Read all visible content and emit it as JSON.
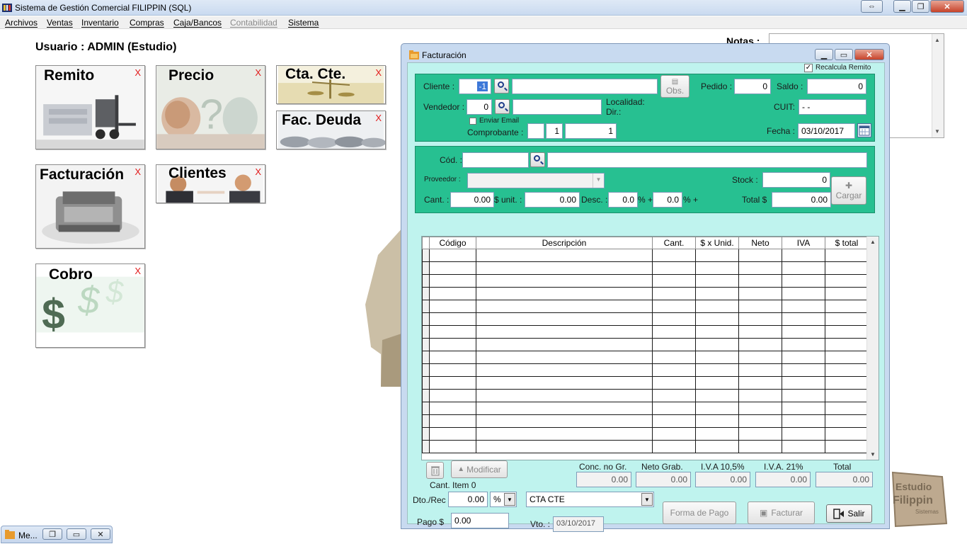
{
  "window": {
    "title": "Sistema de Gestión Comercial FILIPPIN (SQL)"
  },
  "menu": [
    "Archivos",
    "Ventas",
    "Inventario",
    "Compras",
    "Caja/Bancos",
    "Contabilidad",
    "Sistema"
  ],
  "user_label": "Usuario : ADMIN  (Estudio)",
  "tiles": {
    "remito": "Remito",
    "precio": "Precio",
    "ctacte": "Cta. Cte.",
    "facdeuda": "Fac. Deuda",
    "facturacion": "Facturación",
    "clientes": "Clientes",
    "cobro": "Cobro",
    "close_x": "X"
  },
  "notes_label": "Notas :",
  "fac": {
    "title": "Facturación",
    "recalcula": "Recalcula Remito",
    "cliente_label": "Cliente :",
    "cliente_value": "-1",
    "obs": "Obs.",
    "pedido_label": "Pedido :",
    "pedido_value": "0",
    "saldo_label": "Saldo :",
    "saldo_value": "0",
    "vendedor_label": "Vendedor :",
    "vendedor_value": "0",
    "localidad_label": "Localidad:",
    "dir_label": "Dir.:",
    "cuit_label": "CUIT:",
    "cuit_value": "-      -",
    "enviar_email": "Enviar Email",
    "comprobante_label": "Comprobante :",
    "comp_value1": "1",
    "comp_value2": "1",
    "fecha_label": "Fecha :",
    "fecha_value": "03/10/2017",
    "cod_label": "Cód. :",
    "proveedor_label": "Proveedor :",
    "stock_label": "Stock :",
    "stock_value": "0",
    "cargar": "Cargar",
    "cant_label": "Cant. :",
    "cant_value": "0.00",
    "unit_label": "$ unit. :",
    "unit_value": "0.00",
    "desc_label": "Desc. :",
    "desc_value1": "0.0",
    "pct_plus": "% +",
    "desc_value2": "0.0",
    "total_label": "Total $",
    "total_value": "0.00",
    "columns": [
      "Código",
      "Descripción",
      "Cant.",
      "$ x Unid.",
      "Neto",
      "IVA",
      "$ total"
    ],
    "modificar": "Modificar",
    "cant_item": "Cant. Item 0",
    "totals_labels": [
      "Conc. no Gr.",
      "Neto Grab.",
      "I.V.A 10,5%",
      "I.V.A. 21%",
      "Total"
    ],
    "totals_values": [
      "0.00",
      "0.00",
      "0.00",
      "0.00",
      "0.00"
    ],
    "dto_label": "Dto./Rec",
    "dto_value": "0.00",
    "dto_unit": "%",
    "cond_value": "CTA CTE",
    "forma_pago": "Forma de Pago",
    "facturar": "Facturar",
    "salir": "Salir",
    "pago_label": "Pago  $",
    "pago_value": "0.00",
    "vto_label": "Vto. :",
    "vto_value": "03/10/2017"
  },
  "logo_text": [
    "Estudio",
    "Filippin",
    "Sistemas"
  ],
  "taskbar": {
    "label": "Me..."
  }
}
